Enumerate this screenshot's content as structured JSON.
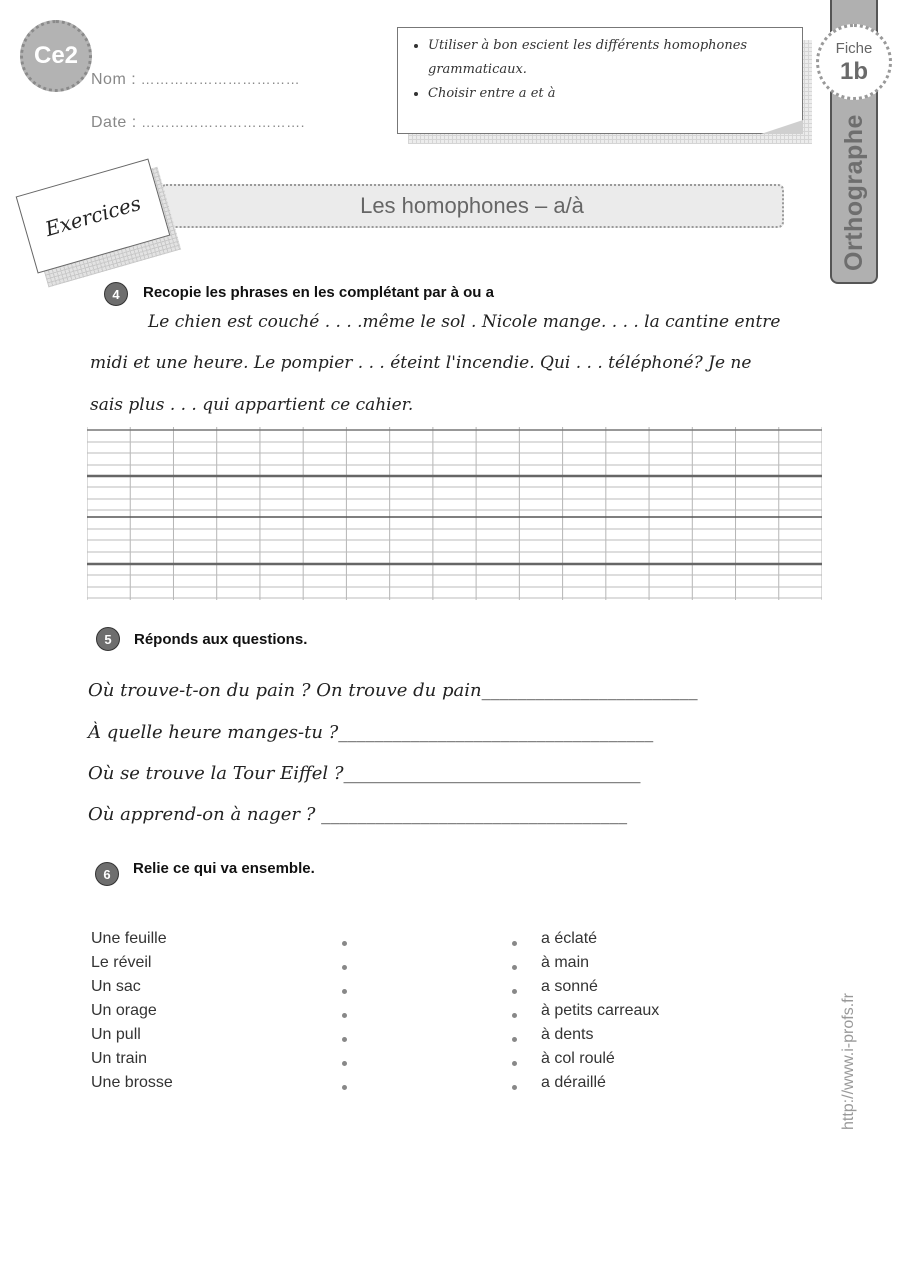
{
  "header": {
    "level_badge": "Ce2",
    "name_label": "Nom :",
    "name_dots": "……………………………",
    "date_label": "Date :",
    "date_dots": "……………………………."
  },
  "objectives": [
    "Utiliser à bon escient les différents homophones grammaticaux.",
    "Choisir entre a et à"
  ],
  "side_tab": {
    "fiche_label": "Fiche",
    "fiche_number": "1b",
    "subject": "Orthographe"
  },
  "banner": {
    "card_label": "Exercices",
    "title": "Les homophones – a/à"
  },
  "exercise4": {
    "number": "4",
    "instruction": "Recopie les phrases en les complétant par à ou a",
    "lines": [
      "Le chien est couché . . . .même le sol . Nicole mange. . . . la cantine entre",
      "midi et une heure. Le pompier . . . éteint l'incendie. Qui  . . . téléphoné? Je ne",
      "sais  plus  . . .  qui appartient ce cahier."
    ]
  },
  "exercise5": {
    "number": "5",
    "instruction": "Réponds aux questions.",
    "questions": [
      "Où trouve-t-on du pain ? On trouve du pain________________________",
      "À quelle heure manges-tu ?___________________________________",
      "Où se trouve la Tour Eiffel ?_________________________________",
      "Où apprend-on à nager ? __________________________________"
    ]
  },
  "exercise6": {
    "number": "6",
    "instruction": "Relie ce qui va ensemble.",
    "left": [
      "Une feuille",
      "Le réveil",
      "Un sac",
      "Un orage",
      "Un pull",
      "Un train",
      "Une brosse"
    ],
    "right": [
      "a éclaté",
      "à main",
      "a sonné",
      "à petits carreaux",
      "à dents",
      "à col roulé",
      "a déraillé"
    ]
  },
  "footer": {
    "url": "http://www.i-profs.fr"
  }
}
